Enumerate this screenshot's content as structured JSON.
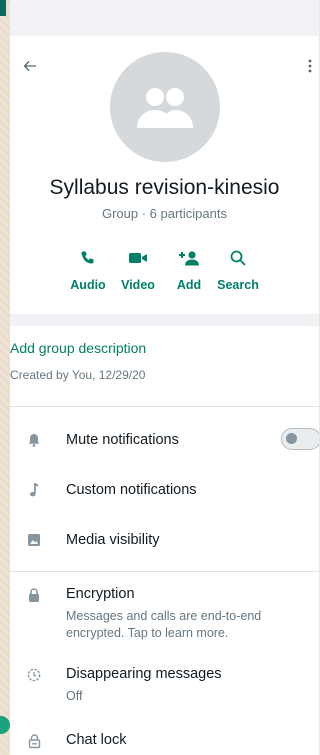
{
  "header": {
    "group_name": "Syllabus revision-kinesio",
    "subtitle": "Group · 6 participants",
    "actions": [
      {
        "label": "Audio",
        "icon": "phone-icon"
      },
      {
        "label": "Video",
        "icon": "video-camera-icon"
      },
      {
        "label": "Add",
        "icon": "add-person-icon"
      },
      {
        "label": "Search",
        "icon": "search-icon"
      }
    ]
  },
  "description": {
    "add_label": "Add group description",
    "created": "Created by You, 12/29/20"
  },
  "settings": [
    {
      "label": "Mute notifications",
      "icon": "bell-icon",
      "toggle_on": false
    },
    {
      "label": "Custom notifications",
      "icon": "music-note-icon"
    },
    {
      "label": "Media visibility",
      "icon": "image-icon"
    }
  ],
  "privacy": {
    "encryption": {
      "title": "Encryption",
      "subtitle": "Messages and calls are end-to-end encrypted. Tap to learn more."
    },
    "disappearing": {
      "title": "Disappearing messages",
      "subtitle": "Off"
    },
    "chat_lock": {
      "title": "Chat lock"
    }
  },
  "colors": {
    "accent": "#008069",
    "icon_gray": "#8696a0",
    "text": "#111b21",
    "subtext": "#667781"
  }
}
